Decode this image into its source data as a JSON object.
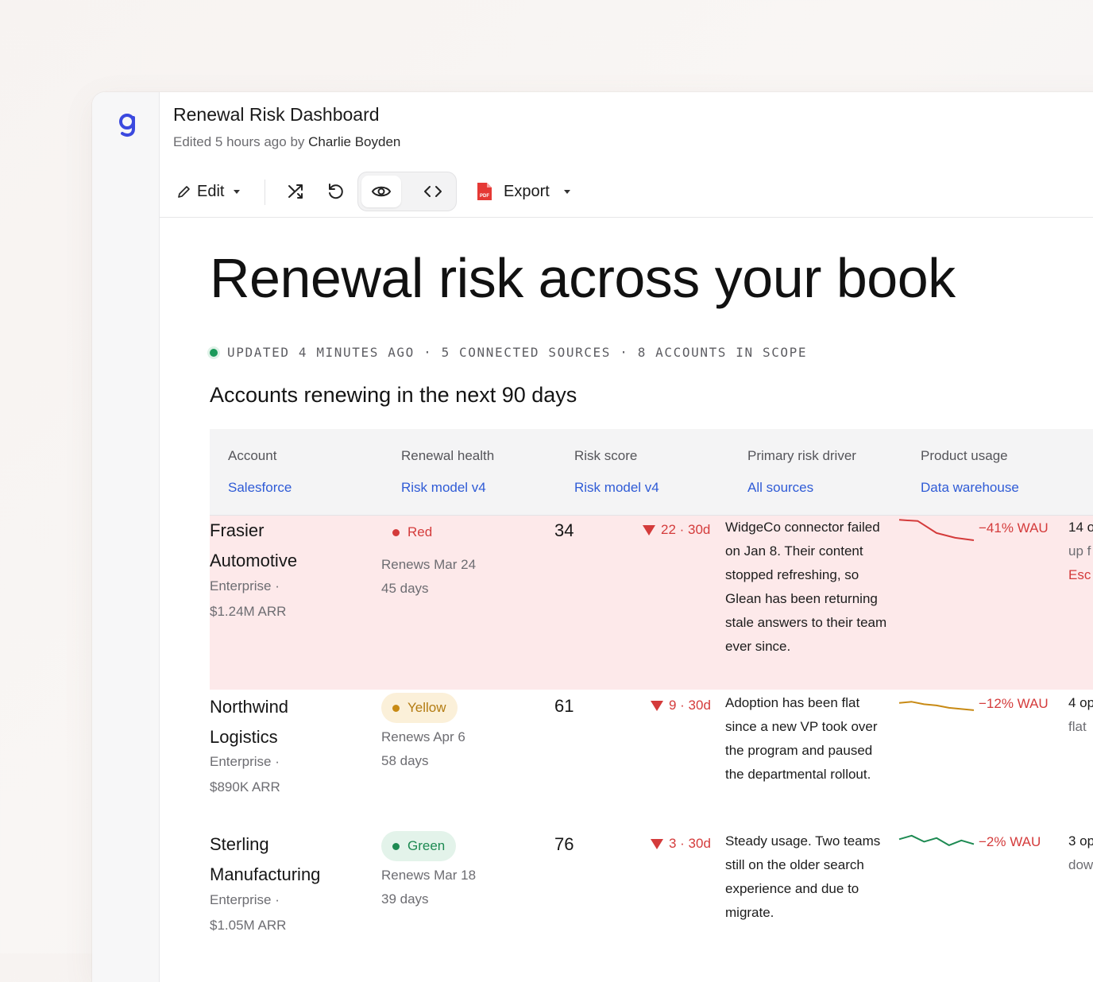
{
  "app": {
    "doc_title": "Renewal Risk Dashboard",
    "edited_prefix": "Edited 5 hours ago by",
    "edited_by": "Charlie Boyden",
    "accent_color": "#3b49df"
  },
  "toolbar": {
    "edit_label": "Edit",
    "export_label": "Export",
    "view_mode": "preview"
  },
  "page": {
    "hero_title": "Renewal risk across your book",
    "status_line": "UPDATED 4 MINUTES AGO · 5 CONNECTED SOURCES · 8 ACCOUNTS IN SCOPE",
    "section_title": "Accounts renewing in the next 90 days"
  },
  "table": {
    "columns": [
      {
        "label": "Account",
        "source": "Salesforce"
      },
      {
        "label": "Renewal health",
        "source": "Risk model v4"
      },
      {
        "label": "Risk score",
        "source": "Risk model v4"
      },
      {
        "label": "Primary risk driver",
        "source": "All sources"
      },
      {
        "label": "Product usage",
        "source": "Data warehouse"
      }
    ],
    "rows": [
      {
        "name_line1": "Frasier",
        "name_line2": "Automotive",
        "tier": "Enterprise ·",
        "arr": "$1.24M ARR",
        "health": "Red",
        "health_color": "#d43b3b",
        "renews": "Renews Mar 24",
        "days": "45 days",
        "score": "34",
        "delta": "22 · 30d",
        "driver": "WidgeCo connector failed on Jan 8. Their content stopped refreshing, so Glean has been returning stale answers to their team ever since.",
        "usage_trend": [
          92,
          90,
          70,
          62,
          58
        ],
        "usage_color": "#d43b3b",
        "wau": "−41% WAU",
        "extra_line1": "14 o",
        "extra_line2": "up f",
        "extra_line3": "Esc"
      },
      {
        "name_line1": "Northwind",
        "name_line2": "Logistics",
        "tier": "Enterprise ·",
        "arr": "$890K ARR",
        "health": "Yellow",
        "health_color": "#c88a14",
        "renews": "Renews Apr 6",
        "days": "58 days",
        "score": "61",
        "delta": "9 · 30d",
        "driver": "Adoption has been flat since a new VP took over the program and paused the departmental rollout.",
        "usage_trend": [
          78,
          80,
          76,
          74,
          70,
          68,
          66
        ],
        "usage_color": "#c88a14",
        "wau": "−12% WAU",
        "extra_line1": "4 op",
        "extra_line2": "flat",
        "extra_line3": ""
      },
      {
        "name_line1": "Sterling",
        "name_line2": "Manufacturing",
        "tier": "Enterprise ·",
        "arr": "$1.05M ARR",
        "health": "Green",
        "health_color": "#1d8a52",
        "renews": "Renews Mar 18",
        "days": "39 days",
        "score": "76",
        "delta": "3 · 30d",
        "driver": "Steady usage. Two teams still on the older search experience and due to migrate.",
        "usage_trend": [
          80,
          86,
          76,
          82,
          70,
          78,
          72
        ],
        "usage_color": "#1d8a52",
        "wau": "−2% WAU",
        "extra_line1": "3 op",
        "extra_line2": "dow",
        "extra_line3": ""
      }
    ]
  }
}
